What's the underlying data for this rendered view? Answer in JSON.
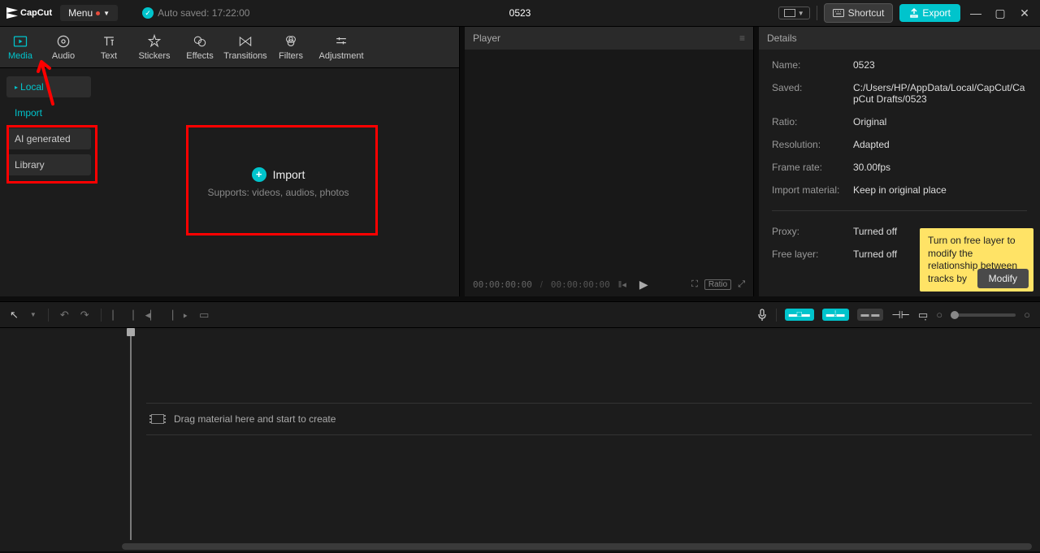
{
  "app": {
    "brand": "CapCut",
    "menu_label": "Menu",
    "autosave": "Auto saved: 17:22:00",
    "title": "0523"
  },
  "titlebar": {
    "shortcut": "Shortcut",
    "export": "Export"
  },
  "top_tabs": [
    {
      "label": "Media",
      "active": true
    },
    {
      "label": "Audio"
    },
    {
      "label": "Text"
    },
    {
      "label": "Stickers"
    },
    {
      "label": "Effects"
    },
    {
      "label": "Transitions"
    },
    {
      "label": "Filters"
    },
    {
      "label": "Adjustment"
    }
  ],
  "side_nav": {
    "local": "Local",
    "import": "Import",
    "ai": "AI generated",
    "library": "Library"
  },
  "import_area": {
    "label": "Import",
    "sub": "Supports: videos, audios, photos"
  },
  "player": {
    "title": "Player",
    "time_current": "00:00:00:00",
    "time_total": "00:00:00:00",
    "ratio": "Ratio"
  },
  "details": {
    "title": "Details",
    "rows": {
      "name": {
        "label": "Name:",
        "value": "0523"
      },
      "saved": {
        "label": "Saved:",
        "value": "C:/Users/HP/AppData/Local/CapCut/CapCut Drafts/0523"
      },
      "ratio": {
        "label": "Ratio:",
        "value": "Original"
      },
      "resolution": {
        "label": "Resolution:",
        "value": "Adapted"
      },
      "framerate": {
        "label": "Frame rate:",
        "value": "30.00fps"
      },
      "import": {
        "label": "Import material:",
        "value": "Keep in original place"
      },
      "proxy": {
        "label": "Proxy:",
        "value": "Turned off"
      },
      "freelayer": {
        "label": "Free layer:",
        "value": "Turned off"
      }
    },
    "tooltip": "Turn on free layer to modify the relationship between tracks by",
    "modify": "Modify"
  },
  "timeline": {
    "drop_hint": "Drag material here and start to create"
  }
}
